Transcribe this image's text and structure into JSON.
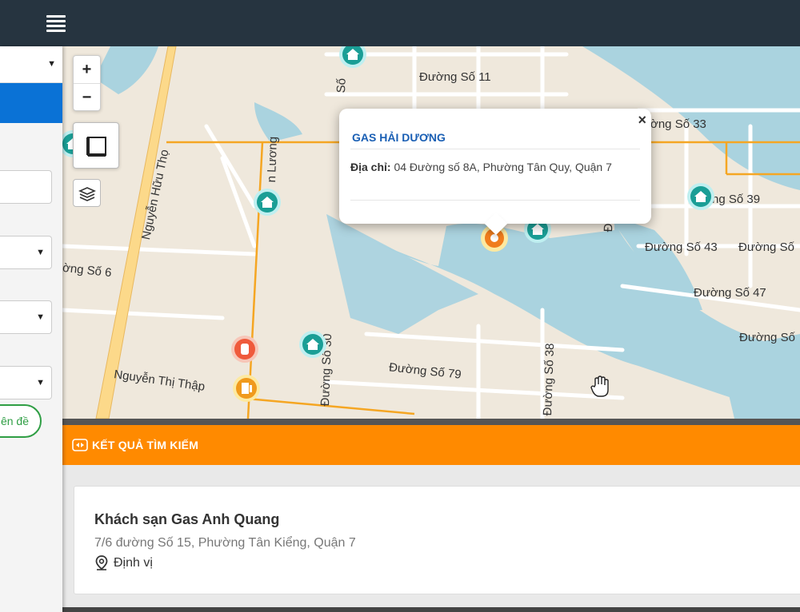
{
  "header": {
    "menu_icon": "hamburger-menu-icon"
  },
  "map": {
    "zoom_in": "+",
    "zoom_out": "−",
    "labels": {
      "duong_so_11": "Đường Số 11",
      "duong_so_33": "ờng Số 33",
      "duong_so_39": "ng Số 39",
      "duong_so_43": "Đường Số 43",
      "duong_so_43b": "Đường Số",
      "duong_so_47": "Đường Số 47",
      "duong_so_right": "Đường Số",
      "duong_so_79": "Đường Số 79",
      "duong_so_6": "ờng Số 6",
      "nguyen_huu_tho": "Nguyễn Hữu Thọ",
      "nguyen_thi_thap": "Nguyễn Thị Thập",
      "duong_so_30": "Đường Số 30",
      "duong_so_38": "Đường Số 38",
      "luong": "n Lương",
      "so_v1": "Số",
      "so_v2": "Đ"
    },
    "popup": {
      "close": "×",
      "title": "GAS HẢI DƯƠNG",
      "address_label": "Địa chỉ:",
      "address_value": "04 Đường số 8A, Phường Tân Quy, Quận 7"
    }
  },
  "sidebar": {
    "button_label": "ên đề",
    "caret": "▼"
  },
  "results": {
    "header": "KẾT QUẢ TÌM KIẾM",
    "items": [
      {
        "name": "Khách sạn Gas Anh Quang",
        "address": "7/6 đường Số 15, Phường Tân Kiểng, Quận 7",
        "locate": "Định vị"
      }
    ]
  },
  "colors": {
    "topbar": "#263440",
    "accent_orange": "#ff8a00",
    "primary_blue": "#0a72d6",
    "green": "#2f9e44",
    "water": "#aad3df",
    "map_land": "#efe8dc"
  }
}
